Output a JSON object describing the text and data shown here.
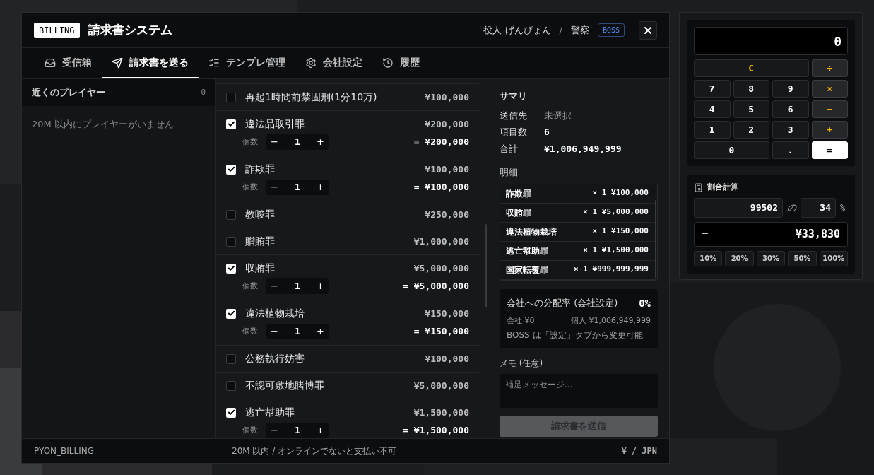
{
  "window": {
    "badge": "BILLING",
    "title": "請求書システム",
    "user": "役人 げんぴょん",
    "separator": "/",
    "role": "警察",
    "rank": "BOSS"
  },
  "tabs": [
    {
      "label": "受信箱",
      "kind": "inbox",
      "selected": false
    },
    {
      "label": "請求書を送る",
      "kind": "send",
      "selected": true
    },
    {
      "label": "テンプレ管理",
      "kind": "list",
      "selected": false
    },
    {
      "label": "会社設定",
      "kind": "gear",
      "selected": false
    },
    {
      "label": "履歴",
      "kind": "history",
      "selected": false
    }
  ],
  "nearby": {
    "title": "近くのプレイヤー",
    "count": "0",
    "empty": "20M 以内にプレイヤーがいません"
  },
  "items": [
    {
      "name": "再起1時間前禁固刑(1分10万)",
      "price": "¥100,000",
      "checked": false
    },
    {
      "name": "違法品取引罪",
      "price": "¥200,000",
      "checked": true,
      "qty_label": "個数",
      "minus": "−",
      "qty": "1",
      "plus": "+",
      "subtotal": "= ¥200,000"
    },
    {
      "name": "詐欺罪",
      "price": "¥100,000",
      "checked": true,
      "qty_label": "個数",
      "minus": "−",
      "qty": "1",
      "plus": "+",
      "subtotal": "= ¥100,000"
    },
    {
      "name": "教唆罪",
      "price": "¥250,000",
      "checked": false
    },
    {
      "name": "贈賄罪",
      "price": "¥1,000,000",
      "checked": false
    },
    {
      "name": "収賄罪",
      "price": "¥5,000,000",
      "checked": true,
      "qty_label": "個数",
      "minus": "−",
      "qty": "1",
      "plus": "+",
      "subtotal": "= ¥5,000,000"
    },
    {
      "name": "違法植物栽培",
      "price": "¥150,000",
      "checked": true,
      "qty_label": "個数",
      "minus": "−",
      "qty": "1",
      "plus": "+",
      "subtotal": "= ¥150,000"
    },
    {
      "name": "公務執行妨害",
      "price": "¥100,000",
      "checked": false
    },
    {
      "name": "不認可敷地賭博罪",
      "price": "¥5,000,000",
      "checked": false
    },
    {
      "name": "逃亡幇助罪",
      "price": "¥1,500,000",
      "checked": true,
      "qty_label": "個数",
      "minus": "−",
      "qty": "1",
      "plus": "+",
      "subtotal": "= ¥1,500,000"
    }
  ],
  "summary": {
    "title": "サマリ",
    "rows": [
      {
        "label": "送信先",
        "value": "未選択",
        "kind": "muted"
      },
      {
        "label": "項目数",
        "value": "6",
        "kind": "strong"
      },
      {
        "label": "合計",
        "value": "¥1,006,949,999",
        "kind": "strong"
      }
    ],
    "details_title": "明細",
    "details": [
      {
        "name": "詐欺罪",
        "amount": "× 1 ¥100,000"
      },
      {
        "name": "収賄罪",
        "amount": "× 1 ¥5,000,000"
      },
      {
        "name": "違法植物栽培",
        "amount": "× 1 ¥150,000"
      },
      {
        "name": "逃亡幇助罪",
        "amount": "× 1 ¥1,500,000"
      },
      {
        "name": "国家転覆罪",
        "amount": "× 1 ¥999,999,999"
      }
    ],
    "share": {
      "label": "会社への分配率 (会社設定)",
      "rate": "0%",
      "company": "会社 ¥0",
      "personal": "個人 ¥1,006,949,999",
      "note": "BOSS は「設定」タブから変更可能"
    },
    "memo_label": "メモ (任意)",
    "memo_placeholder": "補足メッセージ...",
    "send": "請求書を送信",
    "send_disabled": true
  },
  "footer": {
    "left": "PYON_BILLING",
    "center": "20M 以内 / オンラインでないと支払い不可",
    "right": "¥ / JPN"
  },
  "calculator": {
    "display": "0",
    "keys": [
      {
        "label": "C",
        "kind": "clear"
      },
      {
        "label": "÷",
        "kind": "op"
      },
      {
        "label": "7",
        "kind": "digit"
      },
      {
        "label": "8",
        "kind": "digit"
      },
      {
        "label": "9",
        "kind": "digit"
      },
      {
        "label": "×",
        "kind": "op"
      },
      {
        "label": "4",
        "kind": "digit"
      },
      {
        "label": "5",
        "kind": "digit"
      },
      {
        "label": "6",
        "kind": "digit"
      },
      {
        "label": "−",
        "kind": "op"
      },
      {
        "label": "1",
        "kind": "digit"
      },
      {
        "label": "2",
        "kind": "digit"
      },
      {
        "label": "3",
        "kind": "digit"
      },
      {
        "label": "+",
        "kind": "op"
      },
      {
        "label": "0",
        "kind": "digit_wide"
      },
      {
        "label": ".",
        "kind": "digit"
      },
      {
        "label": "=",
        "kind": "equals"
      }
    ]
  },
  "percent": {
    "title": "割合計算",
    "base": "99502",
    "of": "の",
    "rate": "34",
    "unit": "%",
    "equals": "=",
    "result": "¥33,830",
    "presets": [
      "10%",
      "20%",
      "30%",
      "50%",
      "100%"
    ]
  }
}
